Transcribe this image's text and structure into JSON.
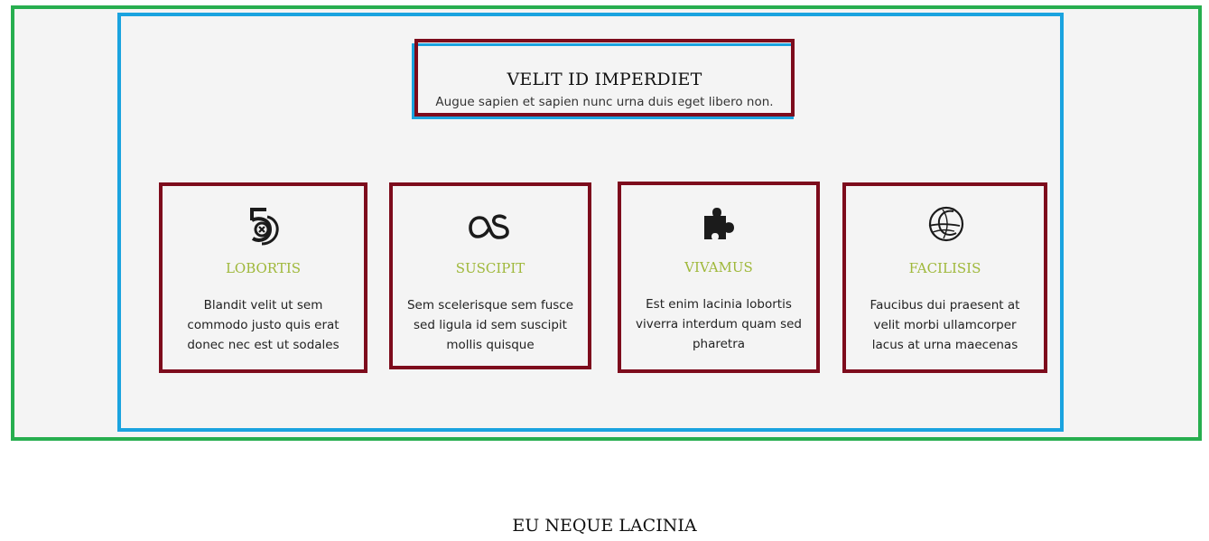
{
  "section": {
    "title": "VELIT ID IMPERDIET",
    "subtitle": "Augue sapien et sapien nunc urna duis eget libero non."
  },
  "cards": [
    {
      "icon": "fivehundredpx-icon",
      "title": "LOBORTIS",
      "text": "Blandit velit ut sem commodo justo quis erat donec nec est ut sodales"
    },
    {
      "icon": "lastfm-icon",
      "title": "SUSCIPIT",
      "text": "Sem scelerisque sem fusce sed ligula id sem suscipit mollis quisque"
    },
    {
      "icon": "puzzle-piece-icon",
      "title": "VIVAMUS",
      "text": "Est enim lacinia lobortis viverra interdum quam sed pharetra"
    },
    {
      "icon": "globe-swirl-icon",
      "title": "FACILISIS",
      "text": "Faucibus dui praesent at velit morbi ullamcorper lacus at urna maecenas"
    }
  ],
  "footer": {
    "title": "EU NEQUE LACINIA"
  },
  "colors": {
    "outer_border": "#27ae4f",
    "inner_border": "#1aa3df",
    "box_border": "#7d0b1c",
    "card_title": "#9fb83a",
    "panel_background": "#f4f4f4"
  }
}
